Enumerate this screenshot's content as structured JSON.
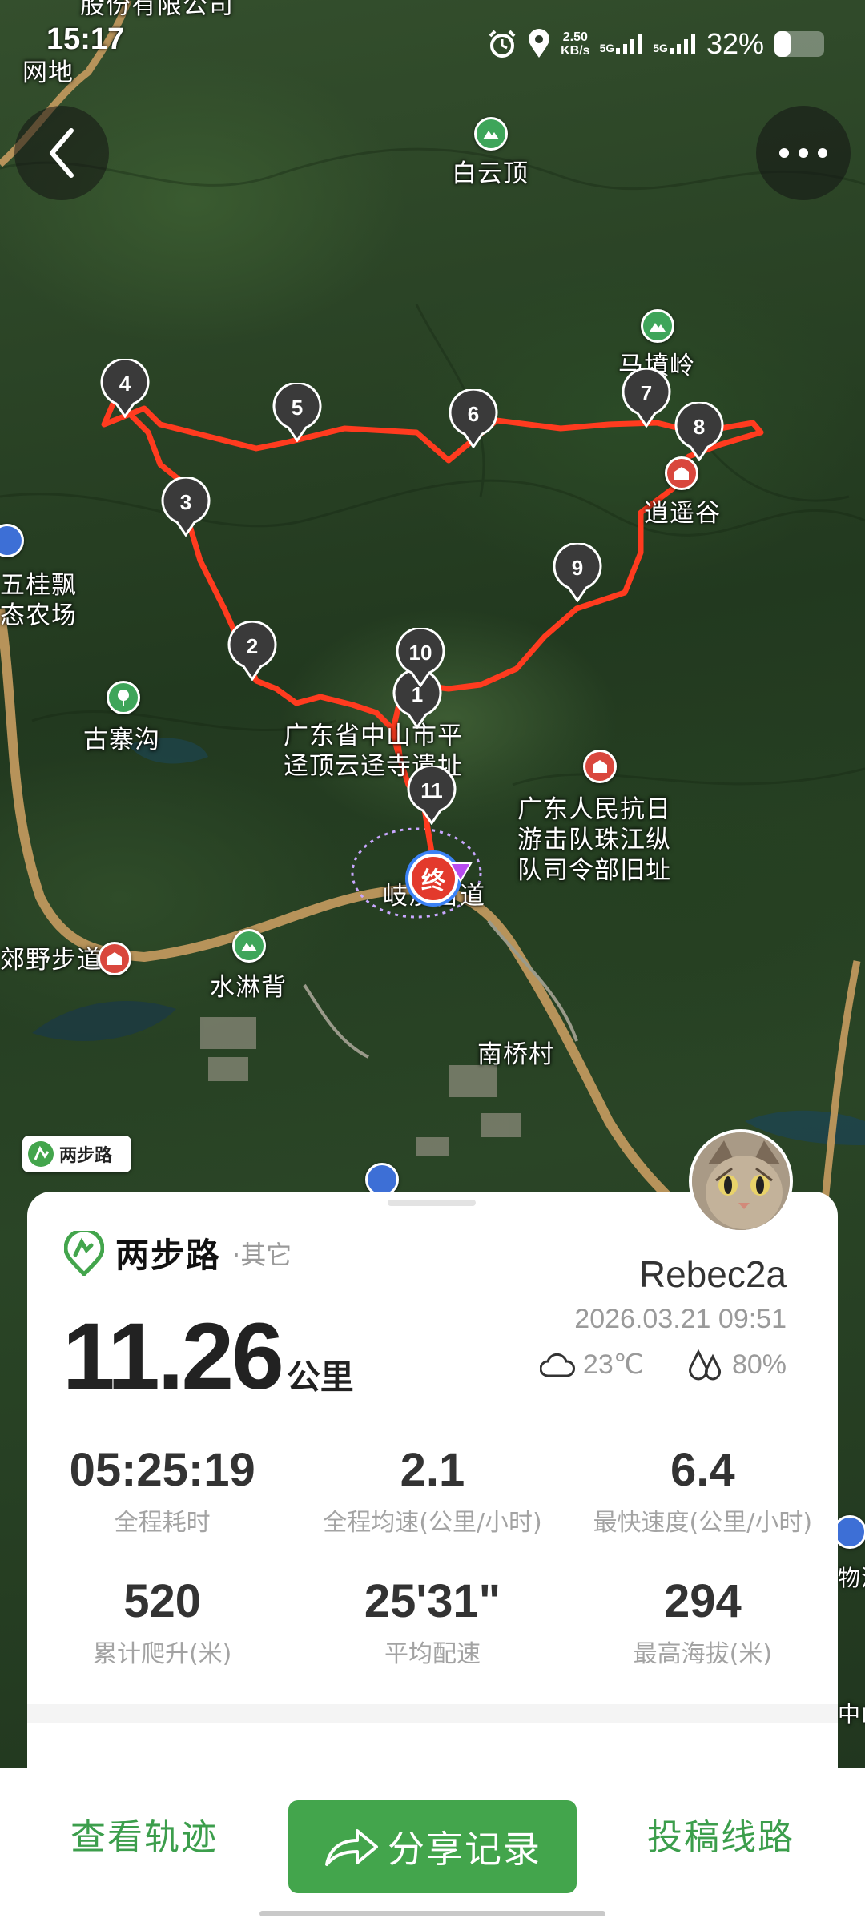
{
  "status_bar": {
    "time": "15:17",
    "net_speed_value": "2.50",
    "net_speed_unit": "KB/s",
    "sig1": "5G",
    "sig2": "5G",
    "battery": "32%"
  },
  "map": {
    "labels": {
      "top_company": "股份有限公司",
      "wangdi": "网地",
      "baiyunding": "白云顶",
      "matianling": "马墳岭",
      "xiaoyaogu": "逍遥谷",
      "wuguipiao": "五桂飘",
      "nongchang": "态农场",
      "guzhaigou": "古寨沟",
      "ruins": "广东省中山市平迳顶云迳寺遗址",
      "hq": "广东人民抗日游击队珠江纵队司令部旧址",
      "qigu": "岐澳古道",
      "yebu": "郊野步道",
      "shuilinbei": "水淋背",
      "nanqiao": "南桥村",
      "right_edge": "物流",
      "right_edge2": "中山"
    },
    "waypoints": [
      "1",
      "2",
      "3",
      "4",
      "5",
      "6",
      "7",
      "8",
      "9",
      "10",
      "11"
    ],
    "end_marker": "终",
    "track_color": "#ff3b1f"
  },
  "app_badge": "两步路",
  "card": {
    "brand": "两步路",
    "category": "·其它",
    "username": "Rebec2a",
    "datetime": "2026.03.21 09:51",
    "temperature": "23℃",
    "humidity": "80%",
    "distance": "11.26",
    "distance_unit": "公里",
    "stats": [
      {
        "value": "05:25:19",
        "label": "全程耗时"
      },
      {
        "value": "2.1",
        "label": "全程均速(公里/小时)"
      },
      {
        "value": "6.4",
        "label": "最快速度(公里/小时)"
      },
      {
        "value": "520",
        "label": "累计爬升(米)"
      },
      {
        "value": "25'31\"",
        "label": "平均配速"
      },
      {
        "value": "294",
        "label": "最高海拔(米)"
      }
    ]
  },
  "bottom": {
    "view_track": "查看轨迹",
    "share": "分享记录",
    "submit_route": "投稿线路"
  },
  "colors": {
    "accent": "#43a54c",
    "link": "#3c9e4c"
  }
}
